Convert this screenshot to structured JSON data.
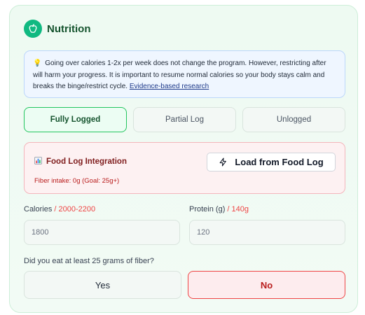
{
  "section": {
    "title": "Nutrition",
    "icon": "apple-icon",
    "accent_color": "#10b981"
  },
  "info": {
    "icon": "lightbulb-icon",
    "text": "Going over calories 1-2x per week does not change the program. However, restricting after will harm your progress. It is important to resume normal calories so your body stays calm and breaks the binge/restrict cycle.",
    "link": "Evidence-based research"
  },
  "log_status": {
    "options": [
      "Fully Logged",
      "Partial Log",
      "Unlogged"
    ],
    "selected": "Fully Logged"
  },
  "food_log": {
    "icon": "bar-chart-icon",
    "title": "Food Log Integration",
    "fiber_text": "Fiber intake: 0g (Goal: 25g+)",
    "button_icon": "lightning-icon",
    "button_label": "Load from Food Log"
  },
  "calories": {
    "label": "Calories",
    "separator": " / ",
    "target": "2000-2200",
    "placeholder": "1800"
  },
  "protein": {
    "label": "Protein (g)",
    "separator": " / ",
    "target": "140g",
    "placeholder": "120"
  },
  "fiber_question": {
    "text": "Did you eat at least 25 grams of fiber?",
    "yes_label": "Yes",
    "no_label": "No",
    "selected": "No"
  }
}
